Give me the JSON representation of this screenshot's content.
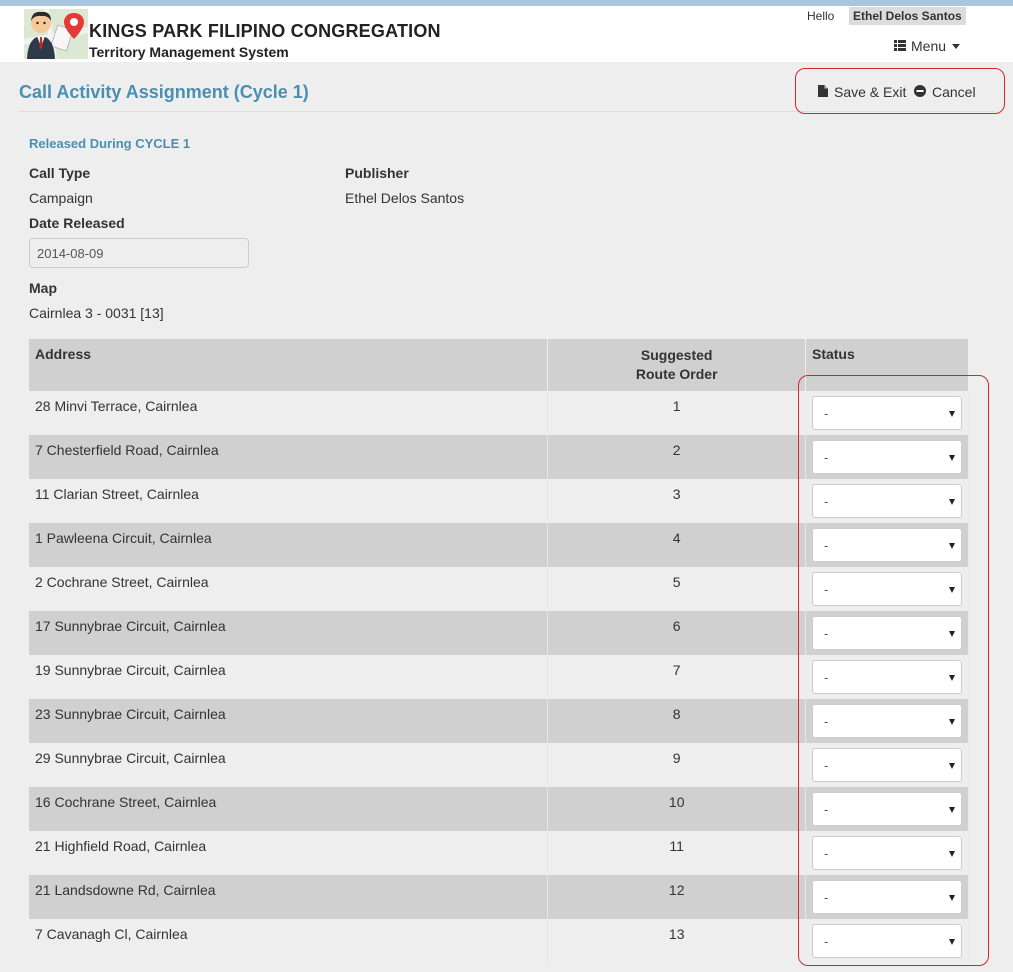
{
  "header": {
    "org_name": "KINGS PARK FILIPINO CONGREGATION",
    "system_name": "Territory Management System",
    "hello_label": "Hello",
    "user_name": "Ethel Delos Santos",
    "menu_label": "Menu"
  },
  "page": {
    "title": "Call Activity Assignment (Cycle 1)",
    "save_label": "Save & Exit",
    "cancel_label": "Cancel"
  },
  "details": {
    "section_title": "Released During CYCLE 1",
    "call_type_label": "Call Type",
    "call_type_value": "Campaign",
    "publisher_label": "Publisher",
    "publisher_value": "Ethel Delos Santos",
    "date_released_label": "Date Released",
    "date_released_value": "2014-08-09",
    "map_label": "Map",
    "map_value": "Cairnlea 3 - 0031 [13]"
  },
  "table": {
    "headers": {
      "address": "Address",
      "order_line1": "Suggested",
      "order_line2": "Route Order",
      "status": "Status"
    },
    "rows": [
      {
        "address": "28 Minvi Terrace, Cairnlea",
        "order": "1",
        "status": "-"
      },
      {
        "address": "7 Chesterfield Road, Cairnlea",
        "order": "2",
        "status": "-"
      },
      {
        "address": "11 Clarian Street, Cairnlea",
        "order": "3",
        "status": "-"
      },
      {
        "address": "1 Pawleena Circuit, Cairnlea",
        "order": "4",
        "status": "-"
      },
      {
        "address": "2 Cochrane Street, Cairnlea",
        "order": "5",
        "status": "-"
      },
      {
        "address": "17 Sunnybrae Circuit, Cairnlea",
        "order": "6",
        "status": "-"
      },
      {
        "address": "19 Sunnybrae Circuit, Cairnlea",
        "order": "7",
        "status": "-"
      },
      {
        "address": "23 Sunnybrae Circuit, Cairnlea",
        "order": "8",
        "status": "-"
      },
      {
        "address": "29 Sunnybrae Circuit, Cairnlea",
        "order": "9",
        "status": "-"
      },
      {
        "address": "16 Cochrane Street, Cairnlea",
        "order": "10",
        "status": "-"
      },
      {
        "address": "21 Highfield Road, Cairnlea",
        "order": "11",
        "status": "-"
      },
      {
        "address": "21 Landsdowne Rd, Cairnlea",
        "order": "12",
        "status": "-"
      },
      {
        "address": "7 Cavanagh Cl, Cairnlea",
        "order": "13",
        "status": "-"
      }
    ]
  },
  "colors": {
    "accent": "#4a8fb0",
    "highlight": "#d9252a"
  }
}
